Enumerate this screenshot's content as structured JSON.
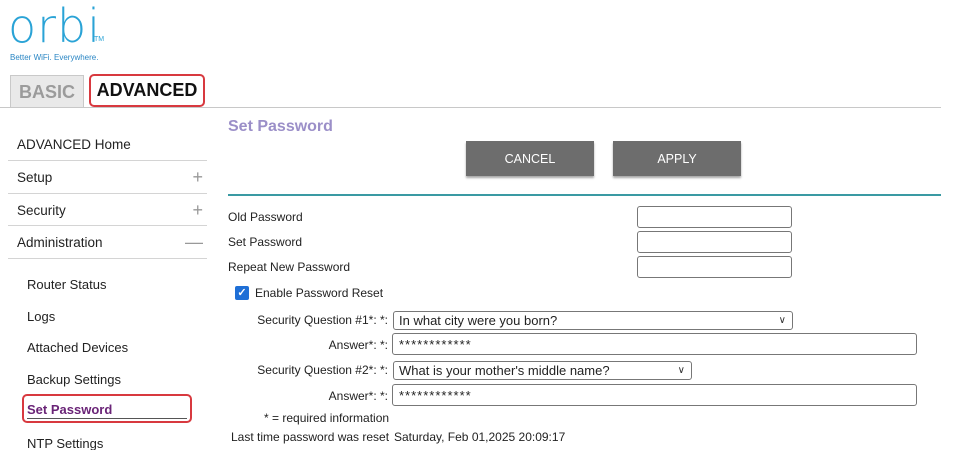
{
  "brand": {
    "logo": "orbi",
    "tm": "TM",
    "tagline": "Better WiFi. Everywhere."
  },
  "tabs": {
    "basic": "BASIC",
    "advanced": "ADVANCED"
  },
  "sidebar": {
    "items": [
      {
        "label": "ADVANCED Home",
        "sign": ""
      },
      {
        "label": "Setup",
        "sign": "+"
      },
      {
        "label": "Security",
        "sign": "+"
      },
      {
        "label": "Administration",
        "sign": "—"
      }
    ],
    "sub_items": [
      {
        "label": "Router Status"
      },
      {
        "label": "Logs"
      },
      {
        "label": "Attached Devices"
      },
      {
        "label": "Backup Settings"
      },
      {
        "label": "Set Password"
      },
      {
        "label": "NTP Settings"
      }
    ]
  },
  "main": {
    "title": "Set Password",
    "cancel_label": "CANCEL",
    "apply_label": "APPLY",
    "old_password_label": "Old Password",
    "set_password_label": "Set Password",
    "repeat_password_label": "Repeat New Password",
    "old_password_value": "",
    "set_password_value": "",
    "repeat_password_value": "",
    "enable_reset_label": "Enable Password Reset",
    "enable_reset_checked": "✓",
    "q1_label": "Security Question #1*: *:",
    "q1_value": "In what city were you born?",
    "a1_label": "Answer*: *:",
    "a1_value": "************",
    "q2_label": "Security Question #2*: *:",
    "q2_value": "What is your mother's middle name?",
    "a2_label": "Answer*: *:",
    "a2_value": "************",
    "required_note": "* = required information",
    "last_reset_label": "Last time password was reset",
    "last_reset_value": "Saturday, Feb 01,2025 20:09:17"
  },
  "colors": {
    "accent_teal": "#3a9aa3",
    "title_purple": "#9b8fc8",
    "highlight_red": "#d8393f",
    "button_gray": "#6d6d6d",
    "logo_blue": "#2aa3d6"
  }
}
